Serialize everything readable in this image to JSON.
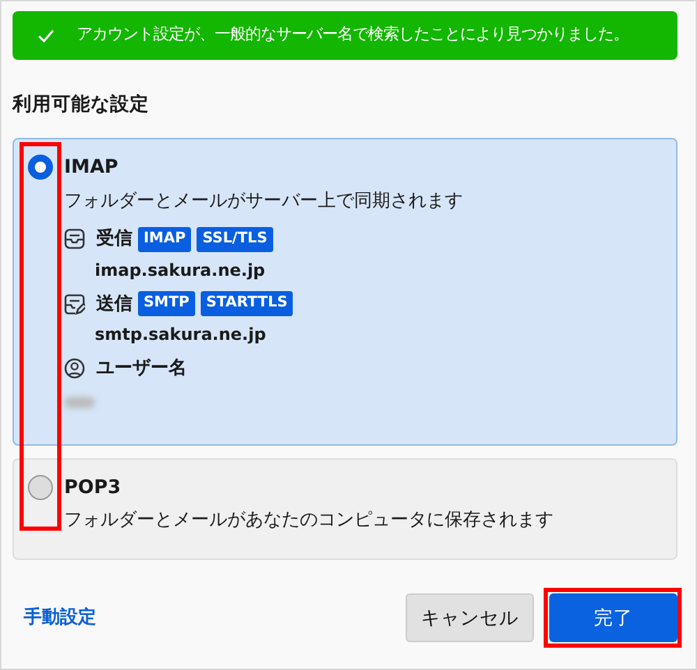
{
  "banner": {
    "text": "アカウント設定が、一般的なサーバー名で検索したことにより見つかりました。"
  },
  "heading": "利用可能な設定",
  "options": [
    {
      "name": "IMAP",
      "selected": true,
      "description": "フォルダーとメールがサーバー上で同期されます",
      "servers": [
        {
          "kind": "incoming",
          "label": "受信",
          "tags": [
            "IMAP",
            "SSL/TLS"
          ],
          "host": "imap.sakura.ne.jp"
        },
        {
          "kind": "outgoing",
          "label": "送信",
          "tags": [
            "SMTP",
            "STARTTLS"
          ],
          "host": "smtp.sakura.ne.jp"
        }
      ],
      "username_label": "ユーザー名"
    },
    {
      "name": "POP3",
      "selected": false,
      "description": "フォルダーとメールがあなたのコンピュータに保存されます"
    }
  ],
  "manual_link": "手動設定",
  "radios_highlighted": true,
  "buttons": [
    {
      "kind": "secondary",
      "label": "キャンセル",
      "highlighted": false
    },
    {
      "kind": "primary",
      "label": "完了",
      "highlighted": true
    }
  ]
}
